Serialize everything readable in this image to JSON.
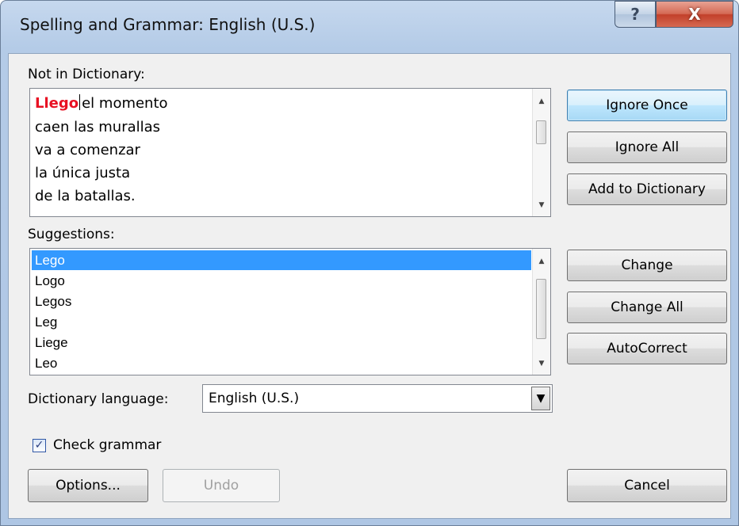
{
  "window": {
    "title": "Spelling and Grammar: English (U.S.)",
    "help_glyph": "?",
    "close_glyph": "X"
  },
  "not_in_dictionary": {
    "label": "Not in Dictionary:",
    "error_word": "Llego",
    "first_line_rest": "el momento",
    "lines": [
      "caen las murallas",
      "va a comenzar",
      "la única justa",
      "de la batallas."
    ]
  },
  "suggestions": {
    "label": "Suggestions:",
    "items": [
      "Lego",
      "Logo",
      "Legos",
      "Leg",
      "Liege",
      "Leo"
    ],
    "selected": "Lego"
  },
  "buttons": {
    "ignore_once": "Ignore Once",
    "ignore_all": "Ignore All",
    "add_to_dictionary": "Add to Dictionary",
    "change": "Change",
    "change_all": "Change All",
    "autocorrect": "AutoCorrect",
    "options": "Options...",
    "undo": "Undo",
    "cancel": "Cancel"
  },
  "dictionary_language": {
    "label": "Dictionary language:",
    "value": "English (U.S.)"
  },
  "check_grammar": {
    "label": "Check grammar",
    "checked": true
  }
}
